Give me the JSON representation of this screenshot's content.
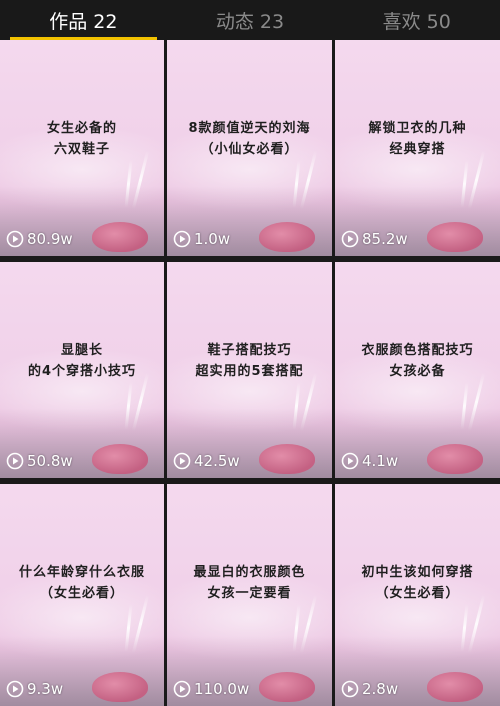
{
  "tabs": [
    {
      "label": "作品 22",
      "active": true
    },
    {
      "label": "动态 23",
      "active": false
    },
    {
      "label": "喜欢 50",
      "active": false
    }
  ],
  "accent_color": "#f2c200",
  "videos": [
    {
      "line1": "女生必备的",
      "line2": "六双鞋子",
      "plays": "80.9w"
    },
    {
      "line1": "8款颜值逆天的刘海",
      "line2": "（小仙女必看）",
      "plays": "1.0w"
    },
    {
      "line1": "解锁卫衣的几种",
      "line2": "经典穿搭",
      "plays": "85.2w"
    },
    {
      "line1": "显腿长",
      "line2": "的4个穿搭小技巧",
      "plays": "50.8w"
    },
    {
      "line1": "鞋子搭配技巧",
      "line2": "超实用的5套搭配",
      "plays": "42.5w"
    },
    {
      "line1": "衣服颜色搭配技巧",
      "line2": "女孩必备",
      "plays": "4.1w"
    },
    {
      "line1": "什么年龄穿什么衣服",
      "line2": "（女生必看）",
      "plays": "9.3w"
    },
    {
      "line1": "最显白的衣服颜色",
      "line2": "女孩一定要看",
      "plays": "110.0w"
    },
    {
      "line1": "初中生该如何穿搭",
      "line2": "（女生必看）",
      "plays": "2.8w"
    }
  ],
  "play_icon": "play-circle-icon"
}
